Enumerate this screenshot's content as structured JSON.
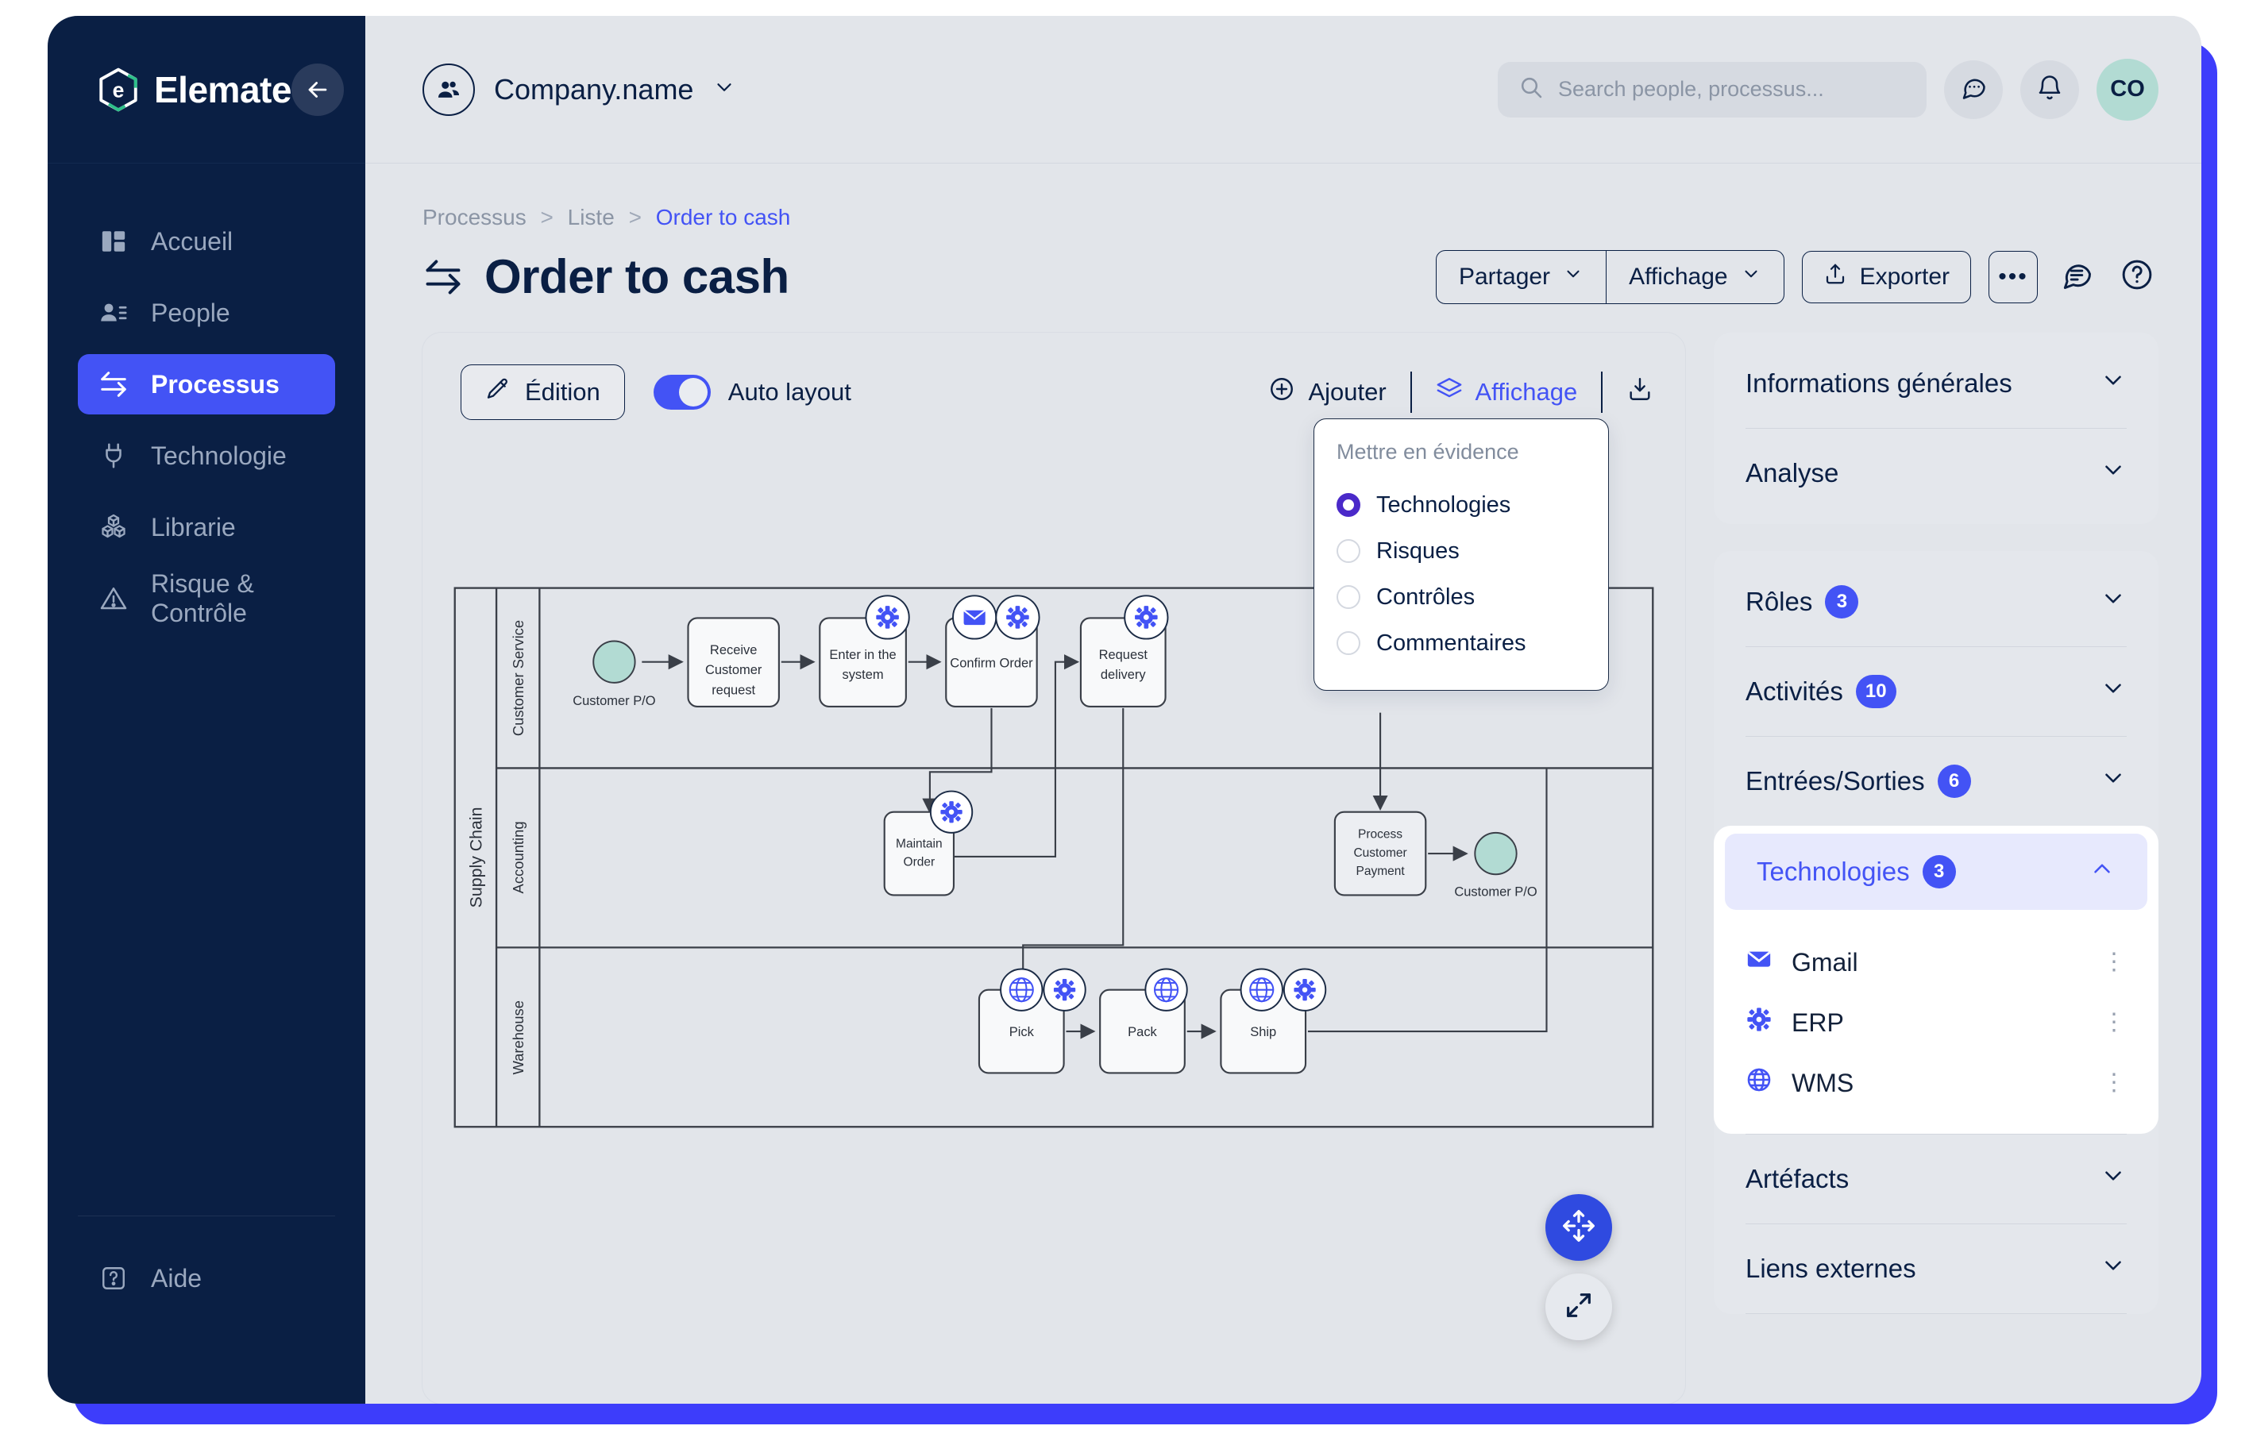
{
  "brand": {
    "name": "Elemate",
    "collapse_icon": "arrow-left-icon"
  },
  "sidebar": {
    "items": [
      {
        "label": "Accueil",
        "icon": "dashboard-icon",
        "active": false
      },
      {
        "label": "People",
        "icon": "people-icon",
        "active": false
      },
      {
        "label": "Processus",
        "icon": "process-arrows-icon",
        "active": true
      },
      {
        "label": "Technologie",
        "icon": "plug-icon",
        "active": false
      },
      {
        "label": "Librarie",
        "icon": "boxes-icon",
        "active": false
      },
      {
        "label": "Risque & Contrôle",
        "icon": "warning-triangle-icon",
        "active": false
      }
    ],
    "help": {
      "label": "Aide",
      "icon": "help-square-icon"
    }
  },
  "topbar": {
    "company": "Company.name",
    "company_icon": "people-group-icon",
    "chevron": "chevron-down-icon",
    "search": {
      "placeholder": "Search people, processus...",
      "value": "",
      "icon": "search-icon"
    },
    "chat_icon": "chat-bubble-icon",
    "bell_icon": "bell-icon",
    "avatar_initials": "CO"
  },
  "breadcrumb": {
    "root": "Processus",
    "middle": "Liste",
    "current": "Order to cash",
    "separator": ">"
  },
  "header": {
    "title": "Order to cash",
    "title_icon": "process-arrows-icon",
    "actions": {
      "partager": "Partager",
      "affichage": "Affichage",
      "exporter": "Exporter",
      "more": "•••",
      "comment_icon": "comment-lines-icon",
      "help_icon": "question-circle-icon"
    }
  },
  "canvas": {
    "edit_button": "Édition",
    "edit_icon": "pencil-icon",
    "auto_layout_label": "Auto layout",
    "auto_layout_on": true,
    "add_button": "Ajouter",
    "add_icon": "plus-circle-icon",
    "view_button": "Affichage",
    "view_icon": "layers-icon",
    "download_icon": "download-icon",
    "dropdown": {
      "title": "Mettre en évidence",
      "options": [
        {
          "label": "Technologies",
          "selected": true
        },
        {
          "label": "Risques",
          "selected": false
        },
        {
          "label": "Contrôles",
          "selected": false
        },
        {
          "label": "Commentaires",
          "selected": false
        }
      ]
    },
    "fab_move_icon": "move-arrows-icon",
    "fab_expand_icon": "expand-arrows-icon"
  },
  "diagram": {
    "pool": "Supply Chain",
    "lanes": [
      "Customer Service",
      "Accounting",
      "Warehouse"
    ],
    "nodes": [
      {
        "id": "start",
        "label": "Customer P/O",
        "type": "event-start",
        "lane": "Customer Service"
      },
      {
        "id": "receive",
        "label": "Receive Customer request",
        "type": "task",
        "lane": "Customer Service",
        "badges": []
      },
      {
        "id": "enter",
        "label": "Enter in the system",
        "type": "task",
        "lane": "Customer Service",
        "badges": [
          "gear-icon"
        ]
      },
      {
        "id": "confirm",
        "label": "Confirm Order",
        "type": "task",
        "lane": "Customer Service",
        "badges": [
          "envelope-icon",
          "gear-icon"
        ]
      },
      {
        "id": "request",
        "label": "Request delivery",
        "type": "task",
        "lane": "Customer Service",
        "badges": [
          "gear-icon"
        ]
      },
      {
        "id": "maintain",
        "label": "Maintain Order",
        "type": "task",
        "lane": "Accounting",
        "badges": [
          "gear-icon"
        ]
      },
      {
        "id": "payment",
        "label": "Process Customer Payment",
        "type": "task",
        "lane": "Accounting",
        "badges": []
      },
      {
        "id": "end",
        "label": "Customer P/O",
        "type": "event-end",
        "lane": "Accounting"
      },
      {
        "id": "pick",
        "label": "Pick",
        "type": "task",
        "lane": "Warehouse",
        "badges": [
          "globe-icon",
          "gear-icon"
        ]
      },
      {
        "id": "pack",
        "label": "Pack",
        "type": "task",
        "lane": "Warehouse",
        "badges": [
          "globe-icon"
        ]
      },
      {
        "id": "ship",
        "label": "Ship",
        "type": "task",
        "lane": "Warehouse",
        "badges": [
          "globe-icon",
          "gear-icon"
        ]
      }
    ]
  },
  "rail": {
    "group_a": [
      {
        "label": "Informations générales",
        "badge": null,
        "expanded": false
      },
      {
        "label": "Analyse",
        "badge": null,
        "expanded": false
      }
    ],
    "group_b": [
      {
        "label": "Rôles",
        "badge": "3",
        "expanded": false
      },
      {
        "label": "Activités",
        "badge": "10",
        "expanded": false
      },
      {
        "label": "Entrées/Sorties",
        "badge": "6",
        "expanded": false
      }
    ],
    "technologies": {
      "label": "Technologies",
      "badge": "3",
      "expanded": true,
      "items": [
        {
          "label": "Gmail",
          "icon": "envelope-icon",
          "menu": "⋮"
        },
        {
          "label": "ERP",
          "icon": "gear-icon",
          "menu": "⋮"
        },
        {
          "label": "WMS",
          "icon": "globe-icon",
          "menu": "⋮"
        }
      ]
    },
    "group_c": [
      {
        "label": "Artéfacts",
        "badge": null,
        "expanded": false
      },
      {
        "label": "Liens externes",
        "badge": null,
        "expanded": false
      }
    ]
  },
  "colors": {
    "accent": "#4353f5",
    "navy": "#0a1f44",
    "mint": "#b2dbd3",
    "canvas_bg": "#e2e5ea"
  }
}
